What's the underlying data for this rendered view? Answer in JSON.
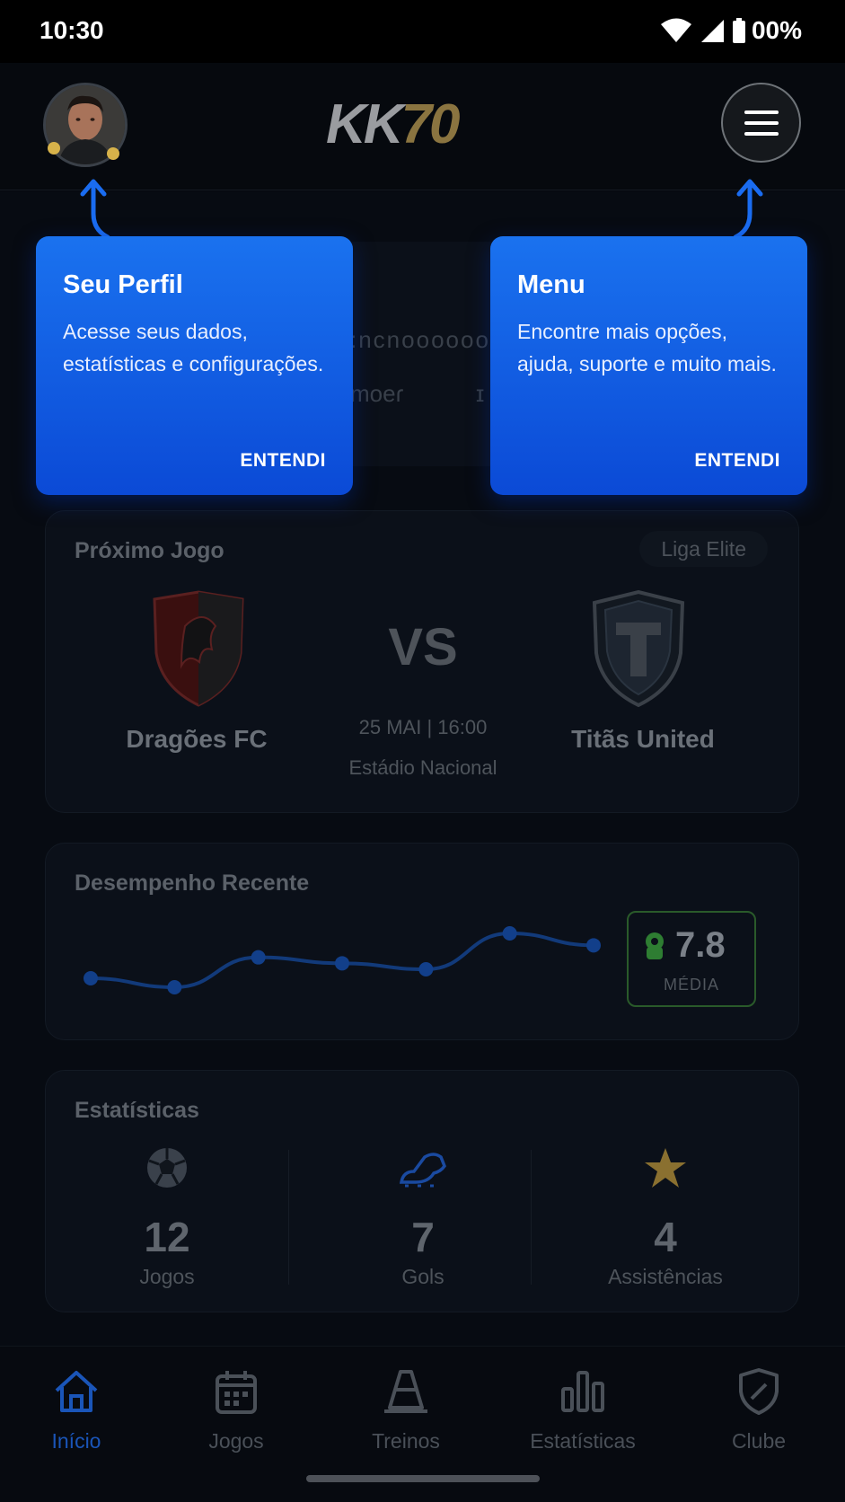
{
  "status_bar": {
    "time": "10:30",
    "battery": "00%"
  },
  "header": {
    "logo_part1": "KK",
    "logo_part2": "70"
  },
  "hero": {
    "blur_line1": ":ncnoooooo",
    "blur_line2": "moeɾ",
    "blur_line3": "ɪ"
  },
  "next_game": {
    "title": "Próximo Jogo",
    "league": "Liga Elite",
    "home_team": "Dragões FC",
    "away_team": "Titãs United",
    "vs": "VS",
    "date": "25 MAI | 16:00",
    "venue": "Estádio Nacional"
  },
  "performance": {
    "title": "Desempenho Recente",
    "rating": "7.8",
    "rating_label": "MÉDIA"
  },
  "chart_data": {
    "type": "line",
    "title": "Desempenho Recente",
    "x": [
      1,
      2,
      3,
      4,
      5,
      6,
      7
    ],
    "values": [
      6.9,
      6.6,
      7.6,
      7.4,
      7.2,
      8.4,
      8.0
    ],
    "xlabel": "",
    "ylabel": "",
    "ylim": [
      6,
      9
    ],
    "grid": false
  },
  "stats": {
    "title": "Estatísticas",
    "items": [
      {
        "icon": "soccer-ball-icon",
        "value": "12",
        "label": "Jogos"
      },
      {
        "icon": "cleat-icon",
        "value": "7",
        "label": "Gols"
      },
      {
        "icon": "star-icon",
        "value": "4",
        "label": "Assistências"
      }
    ]
  },
  "nav": {
    "items": [
      {
        "icon": "home-icon",
        "label": "Início",
        "active": true
      },
      {
        "icon": "calendar-icon",
        "label": "Jogos"
      },
      {
        "icon": "cone-icon",
        "label": "Treinos"
      },
      {
        "icon": "bar-chart-icon",
        "label": "Estatísticas"
      },
      {
        "icon": "shield-icon",
        "label": "Clube"
      }
    ]
  },
  "tooltips": {
    "profile": {
      "title": "Seu Perfil",
      "body": "Acesse seus dados, estatísticas e configurações.",
      "button": "ENTENDI"
    },
    "menu": {
      "title": "Menu",
      "body": "Encontre mais opções, ajuda, suporte e muito mais.",
      "button": "ENTENDI"
    }
  },
  "colors": {
    "accent": "#1a6cf0",
    "active_nav": "#1a55b8",
    "gold": "#d7b24a",
    "rating_border": "#2a5a2a"
  }
}
